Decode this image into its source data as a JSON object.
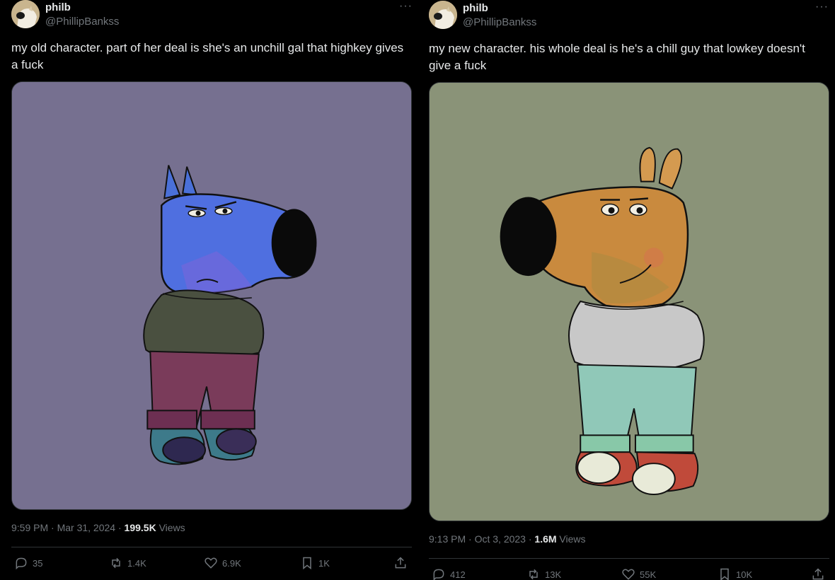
{
  "tweets": [
    {
      "author": {
        "name": "philb",
        "handle": "@PhillipBankss"
      },
      "more_label": "···",
      "text_line1": "my old character. part of her deal is she's an unchill gal that highkey gives",
      "text_line2": "a fuck",
      "media": {
        "description_icon": "blue-dog-character-image",
        "background": "#767090"
      },
      "meta": {
        "time": "9:59 PM · Mar 31, 2024 · ",
        "views_count": "199.5K",
        "views_label": " Views"
      },
      "actions": {
        "replies": "35",
        "retweets": "1.4K",
        "likes": "6.9K",
        "bookmarks": "1K"
      }
    },
    {
      "author": {
        "name": "philb",
        "handle": "@PhillipBankss"
      },
      "more_label": "···",
      "text_line1": "my new character. his whole deal is he's a chill guy that lowkey doesn't",
      "text_line2": "give a fuck",
      "media": {
        "description_icon": "brown-dog-character-image",
        "background": "#8a9378"
      },
      "meta": {
        "time": "9:13 PM · Oct 3, 2023 · ",
        "views_count": "1.6M",
        "views_label": " Views"
      },
      "actions": {
        "replies": "412",
        "retweets": "13K",
        "likes": "55K",
        "bookmarks": "10K"
      }
    }
  ],
  "colors": {
    "background": "#000000",
    "text": "#e7e9ea",
    "muted": "#71767b",
    "border": "#2f3336"
  }
}
